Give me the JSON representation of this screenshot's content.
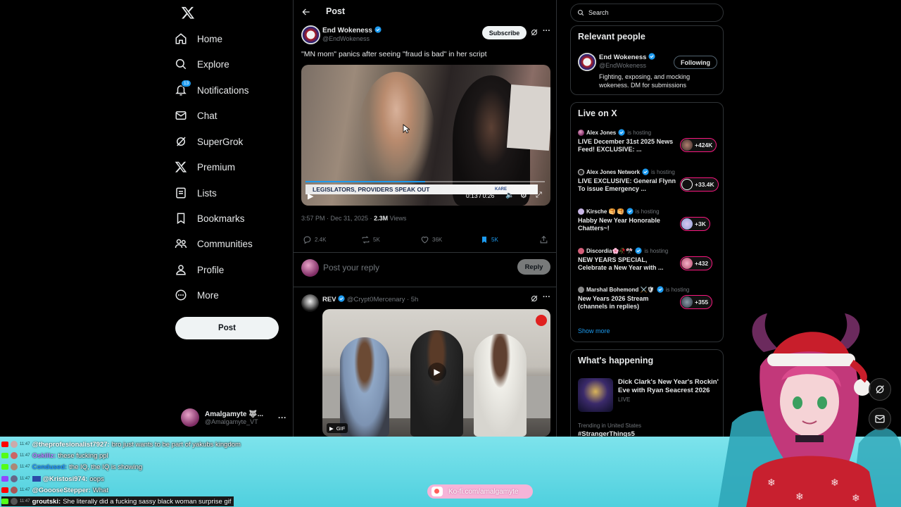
{
  "nav": {
    "items": [
      {
        "label": "Home",
        "icon": "home-icon"
      },
      {
        "label": "Explore",
        "icon": "search-icon"
      },
      {
        "label": "Notifications",
        "icon": "bell-icon",
        "badge": "13"
      },
      {
        "label": "Chat",
        "icon": "mail-icon"
      },
      {
        "label": "SuperGrok",
        "icon": "grok-icon"
      },
      {
        "label": "Premium",
        "icon": "x-icon"
      },
      {
        "label": "Lists",
        "icon": "list-icon"
      },
      {
        "label": "Bookmarks",
        "icon": "bookmark-icon"
      },
      {
        "label": "Communities",
        "icon": "people-icon"
      },
      {
        "label": "Profile",
        "icon": "person-icon"
      },
      {
        "label": "More",
        "icon": "more-circle-icon"
      }
    ],
    "post_label": "Post",
    "account": {
      "name": "Amalgamyte 🐺...",
      "handle": "@Amalgamyte_VT"
    }
  },
  "post": {
    "header_title": "Post",
    "author": {
      "name": "End Wokeness",
      "handle": "@EndWokeness"
    },
    "subscribe_label": "Subscribe",
    "text": "\"MN mom\" panics after seeing \"fraud is bad\" in her script",
    "video": {
      "banner": "LEGISLATORS, PROVIDERS SPEAK OUT",
      "station": "KARE",
      "time": "0:13 / 0:26",
      "progress": 0.5
    },
    "meta": {
      "time": "3:57 PM · Dec 31, 2025 · ",
      "views_count": "2.3M",
      "views_label": " Views"
    },
    "actions": {
      "replies": "2.4K",
      "reposts": "5K",
      "likes": "36K",
      "bookmarks": "5K"
    },
    "reply_placeholder": "Post your reply",
    "reply_label": "Reply"
  },
  "reply_post": {
    "author": "REV",
    "handle_time": "@Crypt0Mercenary · 5h",
    "gif_label": "GIF"
  },
  "right": {
    "search_placeholder": "Search",
    "relevant": {
      "title": "Relevant people",
      "name": "End Wokeness",
      "handle": "@EndWokeness",
      "following_label": "Following",
      "bio": "Fighting, exposing, and mocking wokeness. DM for submissions"
    },
    "live": {
      "title": "Live on X",
      "hosting": "is hosting",
      "items": [
        {
          "host": "Alex Jones",
          "title": "LIVE December 31st 2025 News Feed! EXCLUSIVE: ...",
          "count": "+424K"
        },
        {
          "host": "Alex Jones Network",
          "title": "LIVE EXCLUSIVE: General Flynn To issue Emergency ...",
          "count": "+33.4K"
        },
        {
          "host": "Kirsche 🥞 🥞",
          "title": "Habby New Year Honorable Chatters~!",
          "count": "+3K"
        },
        {
          "host": "Discordia🌸🥀🎌",
          "title": "NEW YEARS SPECIAL, Celebrate a New Year with ...",
          "count": "+432"
        },
        {
          "host": "Marshal Bohemond ⚔️🛡",
          "title": "New Years 2026 Stream (channels in replies)",
          "count": "+355"
        }
      ],
      "show_more": "Show more"
    },
    "happening": {
      "title": "What's happening",
      "event": "Dick Clark's New Year's Rockin' Eve with Ryan Seacrest 2026",
      "event_status": "LIVE",
      "trend_context": "Trending in United States",
      "trend": "#StrangerThings5"
    }
  },
  "chat": [
    {
      "time": "11:47",
      "user": "@theprofesionalist7927:",
      "msg": "bro just wants to be part of yakubs kingdom",
      "color": "#ffffff",
      "plat": "#ff0000"
    },
    {
      "time": "11:47",
      "user": "Oskillz:",
      "msg": "these fucking ppl",
      "color": "#b57cff",
      "plat": "#53fc18"
    },
    {
      "time": "11:47",
      "user": "Condused:",
      "msg": "the IQ, the IQ is showing",
      "color": "#1e90ff",
      "plat": "#53fc18"
    },
    {
      "time": "11:47",
      "user": "@Kristosi974:",
      "msg": "oops",
      "color": "#ffffff",
      "plat": "#9146ff"
    },
    {
      "time": "11:47",
      "user": "@GoooseStepper:",
      "msg": "What",
      "color": "#ffffff",
      "plat": "#ff0000"
    },
    {
      "time": "11:47",
      "user": "groutski:",
      "msg": "She literally did a fucking sassy black woman surprise gif",
      "color": "#ffffff",
      "plat": "#53fc18"
    }
  ],
  "kofi": "Ko-fi.com/amalgamyte",
  "colors": {
    "accent": "#1d9bf0",
    "background": "#000000",
    "border": "#2f3336",
    "overlay": "#5fd6e2",
    "live_ring": "#f91880"
  }
}
